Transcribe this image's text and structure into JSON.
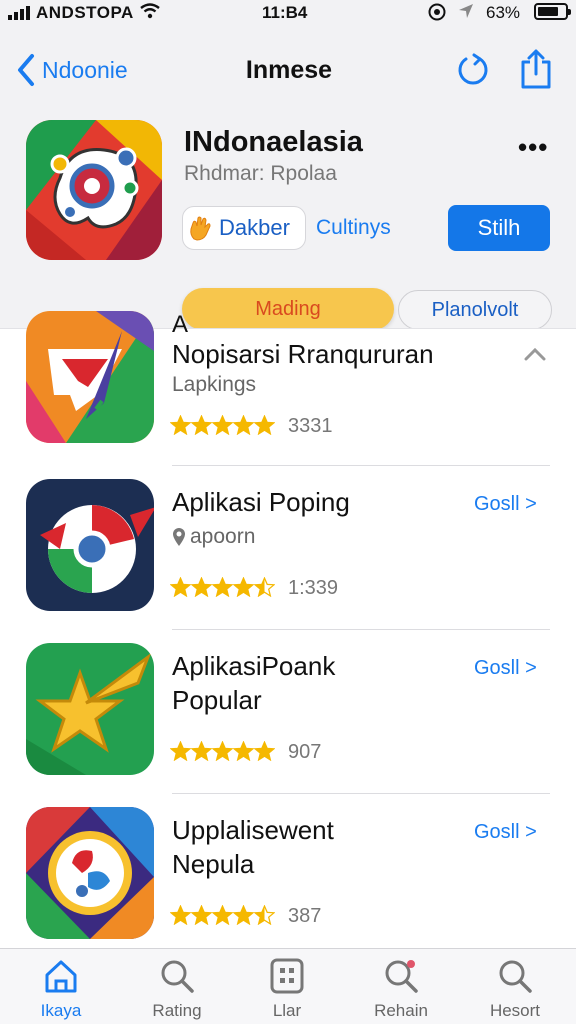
{
  "status_bar": {
    "carrier": "ANDSTOPA",
    "time": "11:B4",
    "battery": "63%"
  },
  "nav": {
    "back_label": "Ndoonie",
    "title": "Inmese"
  },
  "featured": {
    "title": "INdonaelasia",
    "subtitle": "Rhdmar: Rpolaa",
    "more": "•••",
    "secondary_button": "Dakber",
    "link": "Cultinys",
    "primary_button": "Stilh",
    "segment_left": "Mading",
    "segment_right": "Planolvolt"
  },
  "list": {
    "partial_letter": "A",
    "items": [
      {
        "name": "Nopisarsi Rranqururan",
        "sub": "Lapkings",
        "rating": 5,
        "count": "3331",
        "action": ""
      },
      {
        "name": "Aplikasi Poping",
        "sub": "apoorn",
        "rating": 4.5,
        "count": "1:339",
        "action": "Gosll >"
      },
      {
        "name": "AplikasiPoank\nPopular",
        "sub": "",
        "rating": 5,
        "count": "907",
        "action": "Gosll >"
      },
      {
        "name": "Upplalisewent\nNepula",
        "sub": "",
        "rating": 4.5,
        "count": "387",
        "action": "Gosll >"
      }
    ]
  },
  "tabs": [
    {
      "label": "Ikaya",
      "icon": "home-icon",
      "active": true
    },
    {
      "label": "Rating",
      "icon": "search-icon",
      "active": false
    },
    {
      "label": "Llar",
      "icon": "grid-icon",
      "active": false
    },
    {
      "label": "Rehain",
      "icon": "search-badge-icon",
      "active": false
    },
    {
      "label": "Hesort",
      "icon": "search-icon",
      "active": false
    }
  ],
  "colors": {
    "accent": "#1a7cf0",
    "star": "#f5b800",
    "segment": "#f7c64d"
  }
}
